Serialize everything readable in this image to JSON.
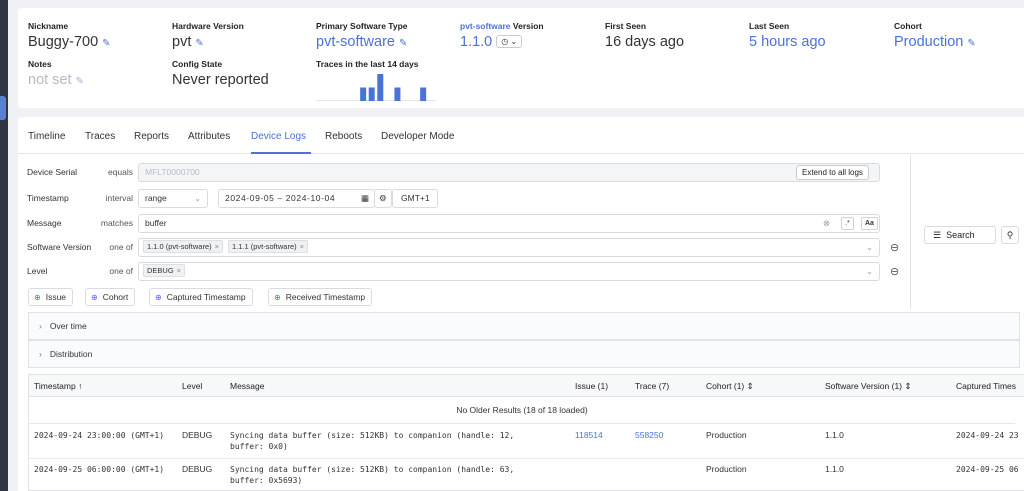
{
  "device": {
    "nickname_label": "Nickname",
    "nickname": "Buggy-700",
    "hardware_label": "Hardware Version",
    "hardware": "pvt",
    "sw_type_label": "Primary Software Type",
    "sw_type": "pvt-software",
    "sw_version_label_prefix": "pvt-software",
    "sw_version_label_suffix": " Version",
    "sw_version": "1.1.0",
    "first_seen_label": "First Seen",
    "first_seen": "16 days ago",
    "last_seen_label": "Last Seen",
    "last_seen": "5 hours ago",
    "cohort_label": "Cohort",
    "cohort": "Production",
    "notes_label": "Notes",
    "notes": "not set",
    "config_label": "Config State",
    "config": "Never reported",
    "traces_label": "Traces in the last 14 days",
    "traces_counts": [
      0,
      0,
      0,
      0,
      0,
      2,
      2,
      4,
      0,
      2,
      0,
      0,
      2,
      0
    ]
  },
  "tabs": [
    "Timeline",
    "Traces",
    "Reports",
    "Attributes",
    "Device Logs",
    "Reboots",
    "Developer Mode"
  ],
  "active_tab": "Device Logs",
  "filters": {
    "serial": {
      "label": "Device Serial",
      "op": "equals",
      "value": "MFLT0000700",
      "extend": "Extend to all logs"
    },
    "timestamp": {
      "label": "Timestamp",
      "op": "interval",
      "mode": "range",
      "range": "2024-09-05 – 2024-10-04",
      "tz": "GMT+1"
    },
    "message": {
      "label": "Message",
      "op": "matches",
      "value": "buffer",
      "regex": ".*",
      "case": "Aa"
    },
    "software": {
      "label": "Software Version",
      "op": "one of",
      "chips": [
        "1.1.0 (pvt-software)",
        "1.1.1 (pvt-software)"
      ]
    },
    "level": {
      "label": "Level",
      "op": "one of",
      "chips": [
        "DEBUG"
      ]
    },
    "add": [
      "Issue",
      "Cohort",
      "Captured Timestamp",
      "Received Timestamp"
    ],
    "search": "Search"
  },
  "accordions": [
    "Over time",
    "Distribution"
  ],
  "table": {
    "headers": [
      "Timestamp",
      "Level",
      "Message",
      "Issue (1)",
      "Trace (7)",
      "Cohort (1)",
      "Software Version (1)",
      "Captured Times"
    ],
    "no_older": "No Older Results (18 of 18 loaded)",
    "rows": [
      {
        "ts": "2024-09-24 23:00:00 (GMT+1)",
        "level": "DEBUG",
        "msg1": "Syncing data buffer (size: 512KB) to companion (handle: 12,",
        "msg2": "buffer: 0x0)",
        "issue": "118514",
        "trace": "558250",
        "cohort": "Production",
        "sw": "1.1.0",
        "captured": "2024-09-24 23"
      },
      {
        "ts": "2024-09-25 06:00:00 (GMT+1)",
        "level": "DEBUG",
        "msg1": "Syncing data buffer (size: 512KB) to companion (handle: 63,",
        "msg2": "buffer: 0x5693)",
        "issue": "",
        "trace": "",
        "cohort": "Production",
        "sw": "1.1.0",
        "captured": "2024-09-25 06"
      }
    ]
  },
  "colors": {
    "accent": "#4a72d9",
    "bar": "#4a72d9"
  }
}
